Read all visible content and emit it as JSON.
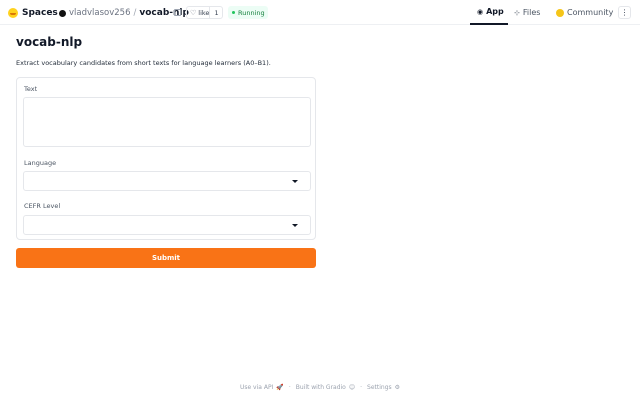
{
  "header": {
    "brand": "Spaces",
    "owner": "vladvlasov256",
    "separator": "/",
    "repo": "vocab-nlp",
    "like_label": "like",
    "like_count": "1",
    "status": "Running",
    "nav": {
      "app": "App",
      "files": "Files",
      "community": "Community"
    },
    "menu_glyph": "⋮"
  },
  "main": {
    "title": "vocab-nlp",
    "description": "Extract vocabulary candidates from short texts for language learners (A0–B1).",
    "form": {
      "text_label": "Text",
      "text_value": "",
      "language_label": "Language",
      "language_value": "",
      "cefr_label": "CEFR Level",
      "cefr_value": ""
    },
    "submit_label": "Submit"
  },
  "footer": {
    "api": "Use via API",
    "api_icon": "🚀",
    "built": "Built with Gradio",
    "built_icon": "😊",
    "settings": "Settings",
    "settings_icon": "⚙",
    "dot": "·"
  },
  "colors": {
    "accent": "#f97316",
    "status_bg": "#ecfdf5",
    "status_fg": "#15803d"
  }
}
